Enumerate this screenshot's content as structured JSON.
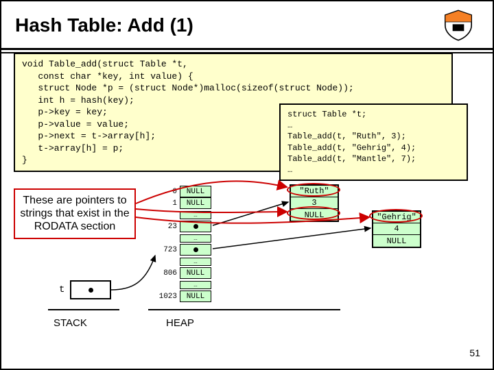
{
  "title": "Hash Table: Add (1)",
  "code_main": "void Table_add(struct Table *t,\n   const char *key, int value) {\n   struct Node *p = (struct Node*)malloc(sizeof(struct Node));\n   int h = hash(key);\n   p->key = key;\n   p->value = value;\n   p->next = t->array[h];\n   t->array[h] = p;\n}",
  "code_calls": "struct Table *t;\n…\nTable_add(t, \"Ruth\", 3);\nTable_add(t, \"Gehrig\", 4);\nTable_add(t, \"Mantle\", 7);\n…",
  "annotation": "These are pointers to strings that exist in the RODATA section",
  "stack": {
    "label": "STACK",
    "var": "t"
  },
  "heap": {
    "label": "HEAP",
    "buckets": [
      {
        "idx": "0",
        "val": "NULL"
      },
      {
        "idx": "1",
        "val": "NULL"
      },
      {
        "ellipsis": "…"
      },
      {
        "idx": "23",
        "val": "●"
      },
      {
        "ellipsis": "…"
      },
      {
        "idx": "723",
        "val": "●"
      },
      {
        "ellipsis": "…"
      },
      {
        "idx": "806",
        "val": "NULL"
      },
      {
        "ellipsis": "…"
      },
      {
        "idx": "1023",
        "val": "NULL"
      }
    ]
  },
  "nodes": {
    "ruth": {
      "key": "\"Ruth\"",
      "value": "3",
      "next": "NULL"
    },
    "gehrig": {
      "key": "\"Gehrig\"",
      "value": "4",
      "next": "NULL"
    }
  },
  "pagenum": "51"
}
